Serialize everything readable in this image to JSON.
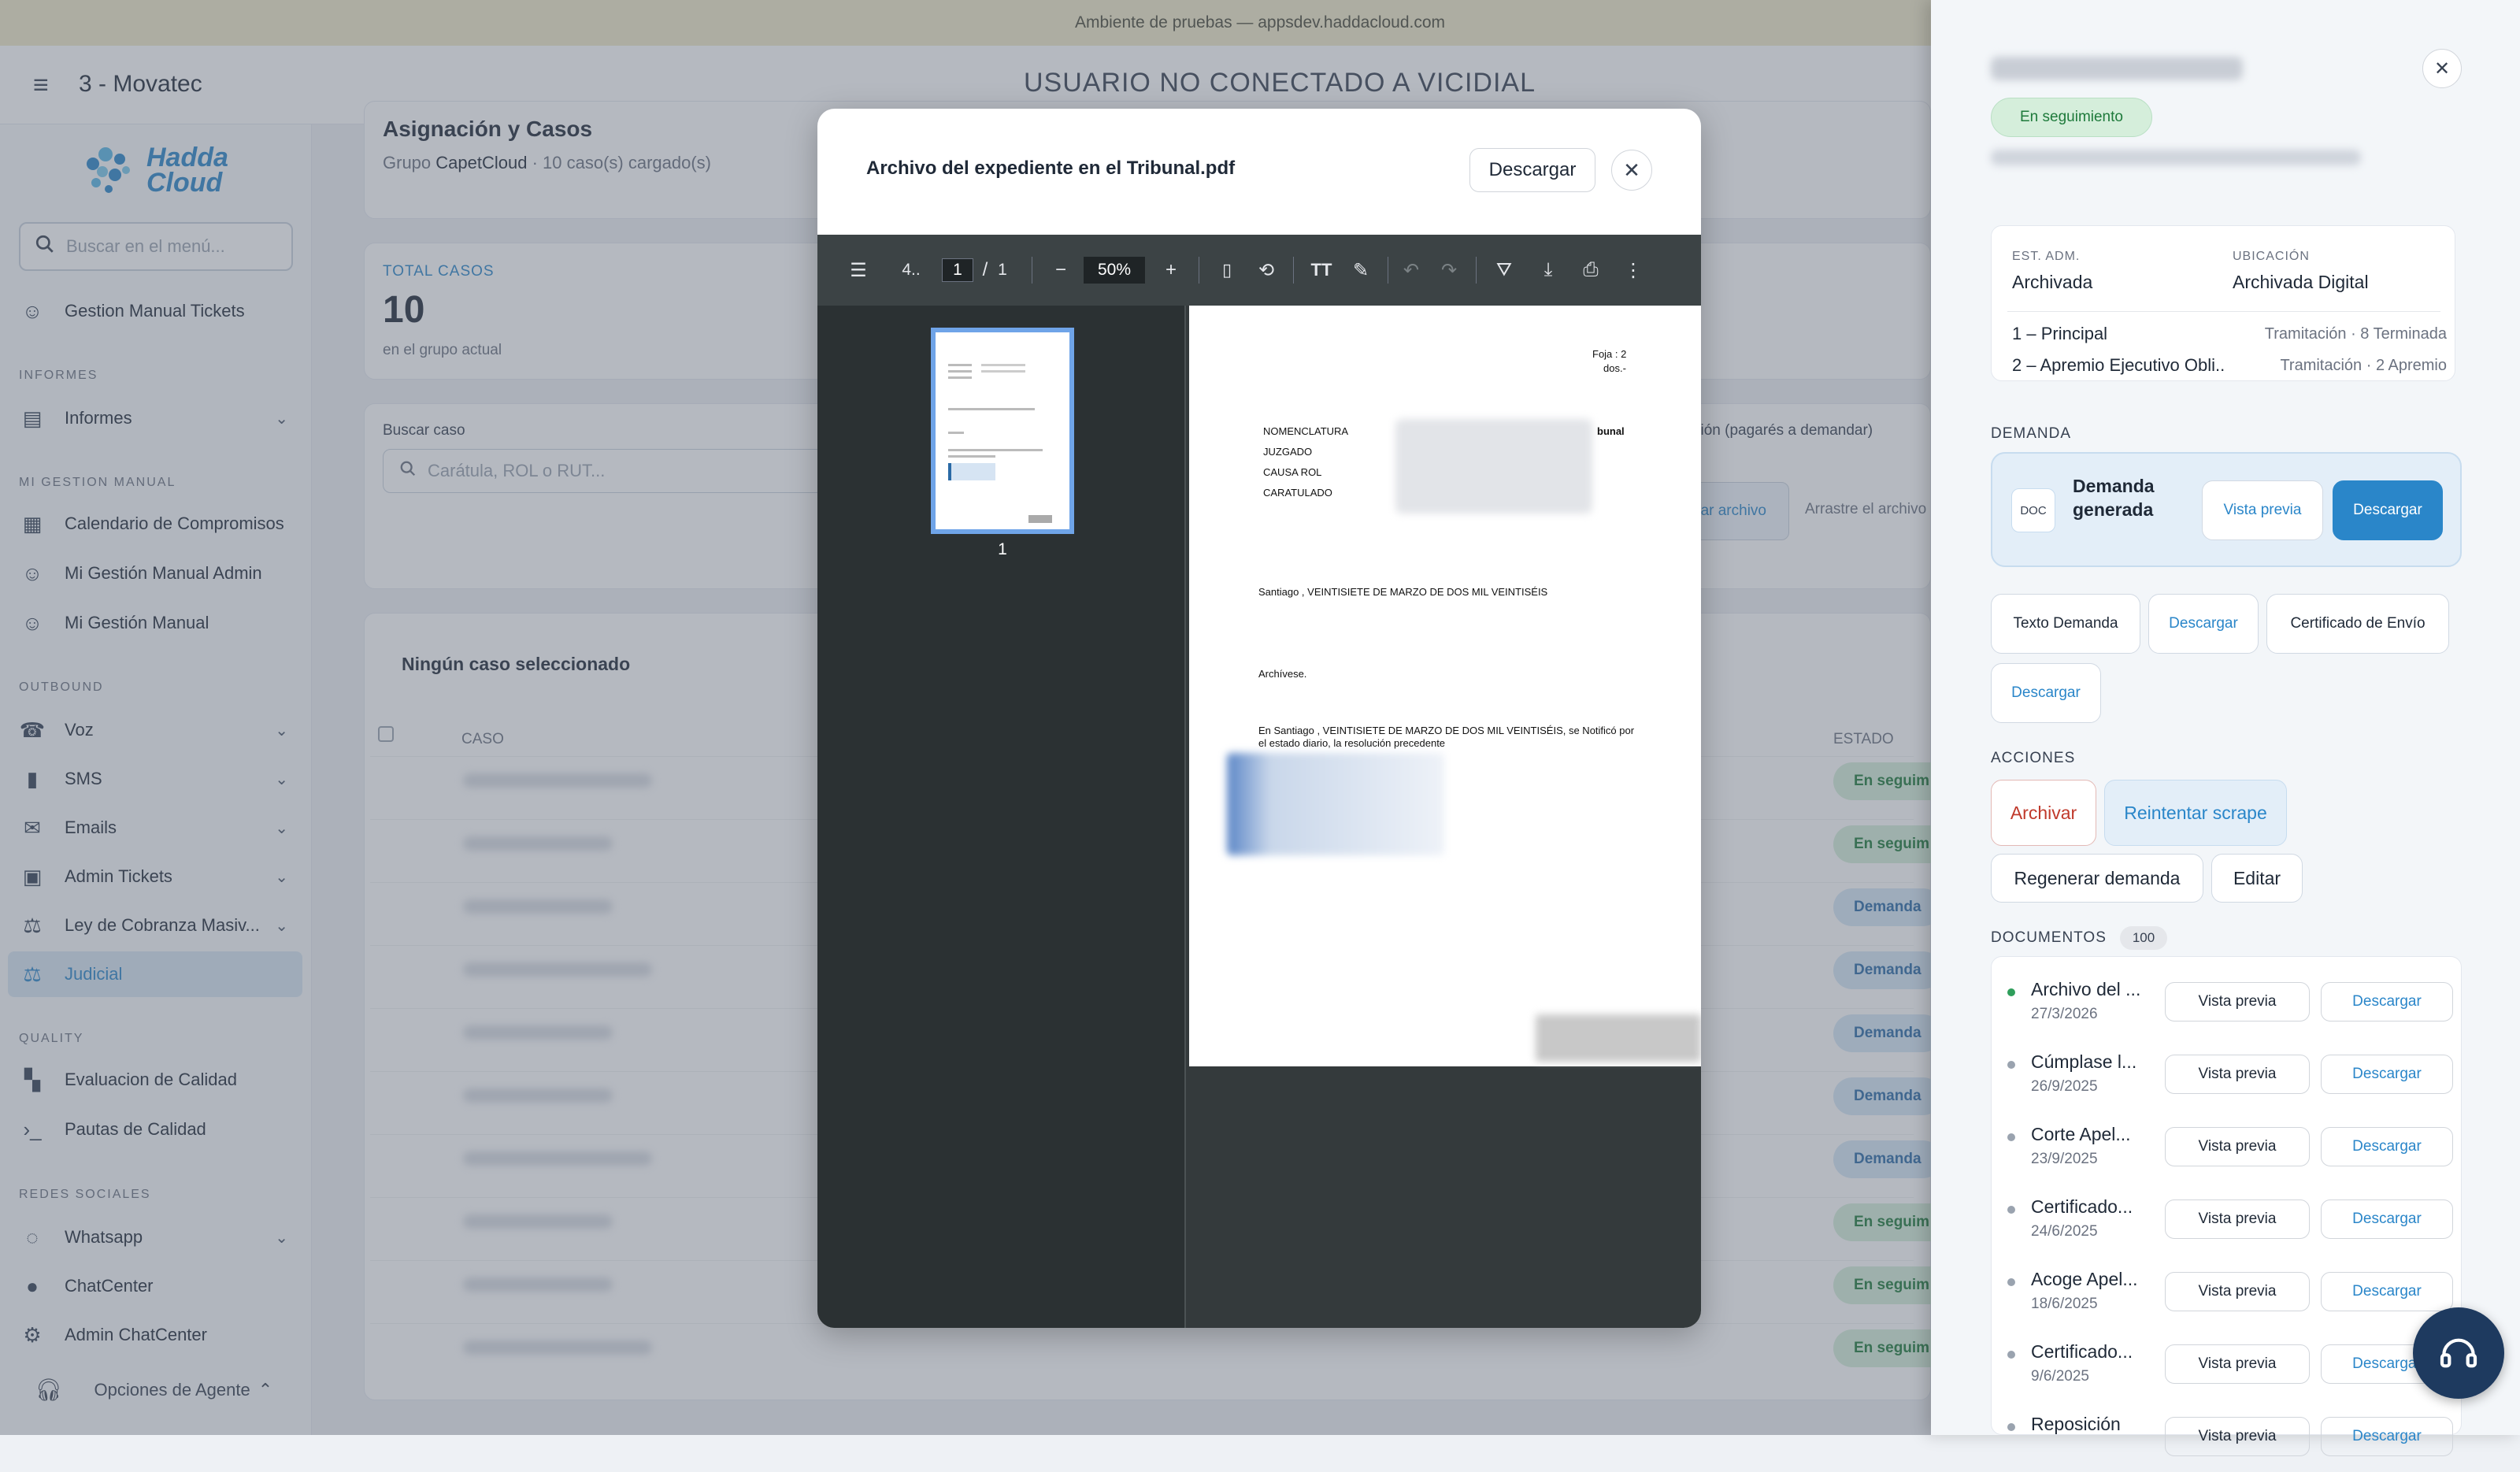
{
  "env_banner": "Ambiente de pruebas — appsdev.haddacloud.com",
  "topbar": {
    "org": "3 - Movatec",
    "status": "USUARIO NO CONECTADO A VICIDIAL"
  },
  "sidebar": {
    "logo": "Hadda Cloud",
    "search_placeholder": "Buscar en el menú...",
    "agent_options": "Opciones de Agente",
    "sections": {
      "informes": "INFORMES",
      "mi_gestion": "MI GESTION MANUAL",
      "outbound": "OUTBOUND",
      "quality": "QUALITY",
      "redes": "REDES SOCIALES"
    },
    "items": [
      {
        "label": "Gestion Manual Tickets",
        "icon": "headset-icon"
      },
      {
        "label": "Informes",
        "icon": "report-icon"
      },
      {
        "label": "Calendario de Compromisos",
        "icon": "calendar-icon"
      },
      {
        "label": "Mi Gestión Manual Admin",
        "icon": "headset-icon"
      },
      {
        "label": "Mi Gestión Manual",
        "icon": "headset-icon"
      },
      {
        "label": "Voz",
        "icon": "phone-icon"
      },
      {
        "label": "SMS",
        "icon": "sms-icon"
      },
      {
        "label": "Emails",
        "icon": "mail-icon"
      },
      {
        "label": "Admin Tickets",
        "icon": "ticket-icon"
      },
      {
        "label": "Ley de Cobranza Masiv...",
        "icon": "gavel-icon"
      },
      {
        "label": "Judicial",
        "icon": "gavel-icon"
      },
      {
        "label": "Evaluacion de Calidad",
        "icon": "quality-icon"
      },
      {
        "label": "Pautas de Calidad",
        "icon": "terminal-icon"
      },
      {
        "label": "Whatsapp",
        "icon": "whatsapp-icon"
      },
      {
        "label": "ChatCenter",
        "icon": "chat-icon"
      },
      {
        "label": "Admin ChatCenter",
        "icon": "admin-chat-icon"
      }
    ]
  },
  "main": {
    "title": "Asignación y Casos",
    "subtitle_prefix": "Grupo",
    "group": "CapetCloud",
    "subtitle_suffix": "· 10 caso(s) cargado(s)",
    "total_label": "TOTAL CASOS",
    "total_value": "10",
    "total_sub": "en el grupo actual",
    "search_label": "Buscar caso",
    "search_placeholder": "Carátula, ROL o RUT...",
    "right_label": "ción (pagarés a demandar)",
    "upload_button": "nar archivo",
    "drag_text": "Arrastre el archivo",
    "no_case": "Ningún caso seleccionado",
    "col_caso": "CASO",
    "col_estado": "ESTADO",
    "row_states": [
      "En seguim",
      "En seguim",
      "Demanda",
      "Demanda",
      "Demanda",
      "Demanda",
      "Demanda",
      "En seguim",
      "En seguim",
      "En seguim"
    ]
  },
  "modal": {
    "title": "Archivo del expediente en el Tribunal.pdf",
    "download": "Descargar",
    "viewer": {
      "doc_short": "4..",
      "page": "1",
      "pages": "1",
      "zoom": "50%",
      "thumb_num": "1",
      "page_text": {
        "foja": "Foja : 2",
        "dos": "dos.-",
        "tribunal": "bunal",
        "nomenclatura": "NOMENCLATURA",
        "juzgado": "JUZGADO",
        "causa_rol": "CAUSA ROL",
        "caratulado": "CARATULADO",
        "fecha": "Santiago , VEINTISIETE DE MARZO DE DOS MIL VEINTISÉIS",
        "archivese": "Archívese.",
        "notif": "En Santiago , VEINTISIETE DE MARZO DE DOS MIL VEINTISÉIS, se Notificó por el estado diario, la resolución precedente"
      }
    }
  },
  "panel": {
    "status": "En seguimiento",
    "est_adm_label": "EST. ADM.",
    "est_adm": "Archivada",
    "ubic_label": "UBICACIÓN",
    "ubic": "Archivada Digital",
    "proc1": "1 – Principal",
    "proc1_state": "Tramitación · 8 Terminada",
    "proc2": "2 – Apremio Ejecutivo Obli...",
    "proc2_state": "Tramitación · 2 Apremio",
    "demanda_title": "DEMANDA",
    "doc_badge": "DOC",
    "demanda_gen": "Demanda generada",
    "vista_previa": "Vista previa",
    "descargar": "Descargar",
    "texto_demanda": "Texto Demanda",
    "certificado_envio": "Certificado de Envío",
    "acciones_title": "ACCIONES",
    "archivar": "Archivar",
    "reintentar": "Reintentar scrape",
    "regenerar": "Regenerar demanda",
    "editar": "Editar",
    "documentos_title": "DOCUMENTOS",
    "documentos_count": "100",
    "docs": [
      {
        "name": "Archivo del ...",
        "date": "27/3/2026"
      },
      {
        "name": "Cúmplase l...",
        "date": "26/9/2025"
      },
      {
        "name": "Corte Apel...",
        "date": "23/9/2025"
      },
      {
        "name": "Certificado...",
        "date": "24/6/2025"
      },
      {
        "name": "Acoge Apel...",
        "date": "18/6/2025"
      },
      {
        "name": "Certificado...",
        "date": "9/6/2025"
      },
      {
        "name": "Reposición",
        "date": ""
      }
    ]
  }
}
